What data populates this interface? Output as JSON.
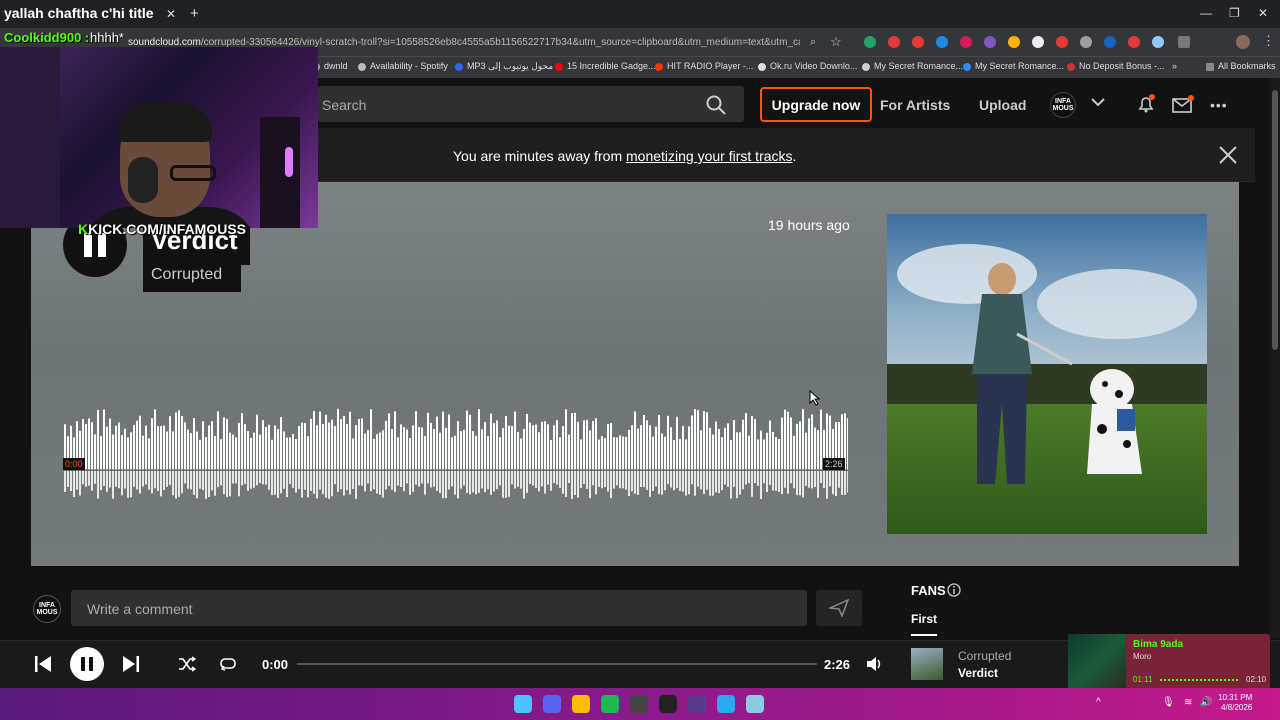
{
  "stream": {
    "title": "yallah chaftha c'hi title",
    "chat_user": "Coolkidd900 :",
    "chat_message": "hhhh*",
    "kick_prefix": "K",
    "kick_label": "KICK.COM/INFAMOUSS"
  },
  "browser": {
    "url_host": "soundcloud.com",
    "url_path": "/corrupted-330564426/vinyl-scratch-troll?si=10558526eb8c4555a5b1156522717b34&utm_source=clipboard&utm_medium=text&utm_campaig...",
    "bookmarks": [
      {
        "label": "dwnld",
        "color": "#9aa0a6"
      },
      {
        "label": "Availability - Spotify",
        "color": "#bbbbbb"
      },
      {
        "label": "MP3 محول يوتيوب إلى",
        "color": "#3366ff"
      },
      {
        "label": "15 Incredible Gadge...",
        "color": "#ff0000"
      },
      {
        "label": "HIT RADIO Player -...",
        "color": "#ff3300"
      },
      {
        "label": "Ok.ru Video Downlo...",
        "color": "#dddddd"
      },
      {
        "label": "My Secret Romance...",
        "color": "#cccccc"
      },
      {
        "label": "My Secret Romance...",
        "color": "#3388ff"
      },
      {
        "label": "No Deposit Bonus -...",
        "color": "#cc3333"
      }
    ],
    "all_bookmarks": "All Bookmarks"
  },
  "header": {
    "search_placeholder": "Search",
    "upgrade_label": "Upgrade now",
    "for_artists_label": "For Artists",
    "upload_label": "Upload",
    "avatar_text": "INFA MOUS"
  },
  "banner": {
    "text_before": "You are minutes away from ",
    "link_text": "monetizing your first tracks",
    "text_after": "."
  },
  "track": {
    "title": "Verdict",
    "artist": "Corrupted",
    "posted": "19 hours ago",
    "time_start": "0:00",
    "time_end": "2:26"
  },
  "comment": {
    "placeholder": "Write a comment",
    "avatar_text": "INFA MOUS"
  },
  "fans": {
    "title": "FANS",
    "tab_first": "First"
  },
  "player": {
    "current_time": "0:00",
    "duration": "2:26",
    "progress": 0,
    "now_playing_artist": "Corrupted",
    "now_playing_title": "Verdict"
  },
  "spotify_widget": {
    "title": "Bima 9ada",
    "artist": "Moro",
    "current": "01:11",
    "end": "02:10"
  },
  "taskbar": {
    "time": "10:31 PM",
    "date": "4/8/2026"
  },
  "colors": {
    "accent": "#ff5500",
    "kick_green": "#53fc18"
  }
}
